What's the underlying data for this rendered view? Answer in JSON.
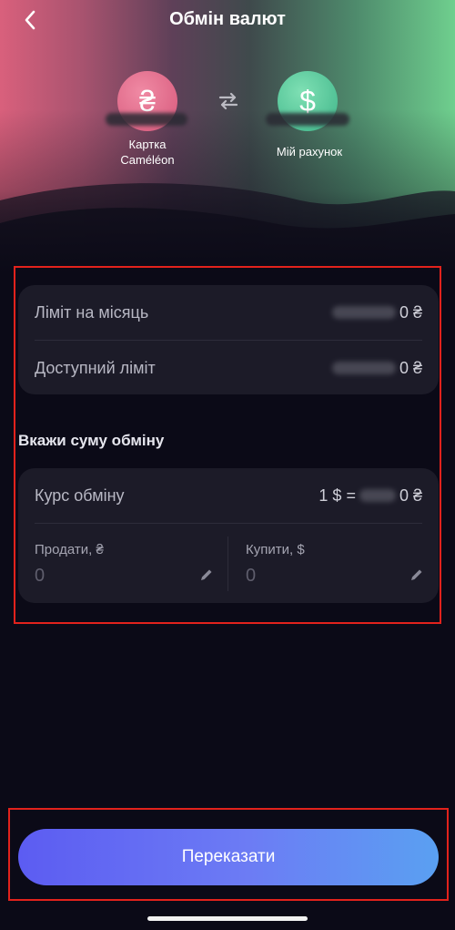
{
  "header": {
    "title": "Обмін валют"
  },
  "from_account": {
    "symbol": "₴",
    "label_line1": "Картка",
    "label_line2": "Caméléon"
  },
  "to_account": {
    "symbol": "$",
    "label": "Мій рахунок"
  },
  "limits": {
    "monthly_label": "Ліміт на місяць",
    "monthly_value_suffix": "0 ₴",
    "available_label": "Доступний ліміт",
    "available_value_suffix": "0 ₴"
  },
  "exchange": {
    "section_title": "Вкажи суму обміну",
    "rate_label": "Курс обміну",
    "rate_prefix": "1 $ = ",
    "rate_suffix": "0 ₴",
    "sell_label": "Продати, ₴",
    "sell_value": "0",
    "buy_label": "Купити, $",
    "buy_value": "0"
  },
  "cta": {
    "label": "Переказати"
  },
  "colors": {
    "accent": "#5c5cf2",
    "highlight_outline": "#e2221c",
    "uah": "#d6577a",
    "usd": "#3db488"
  }
}
